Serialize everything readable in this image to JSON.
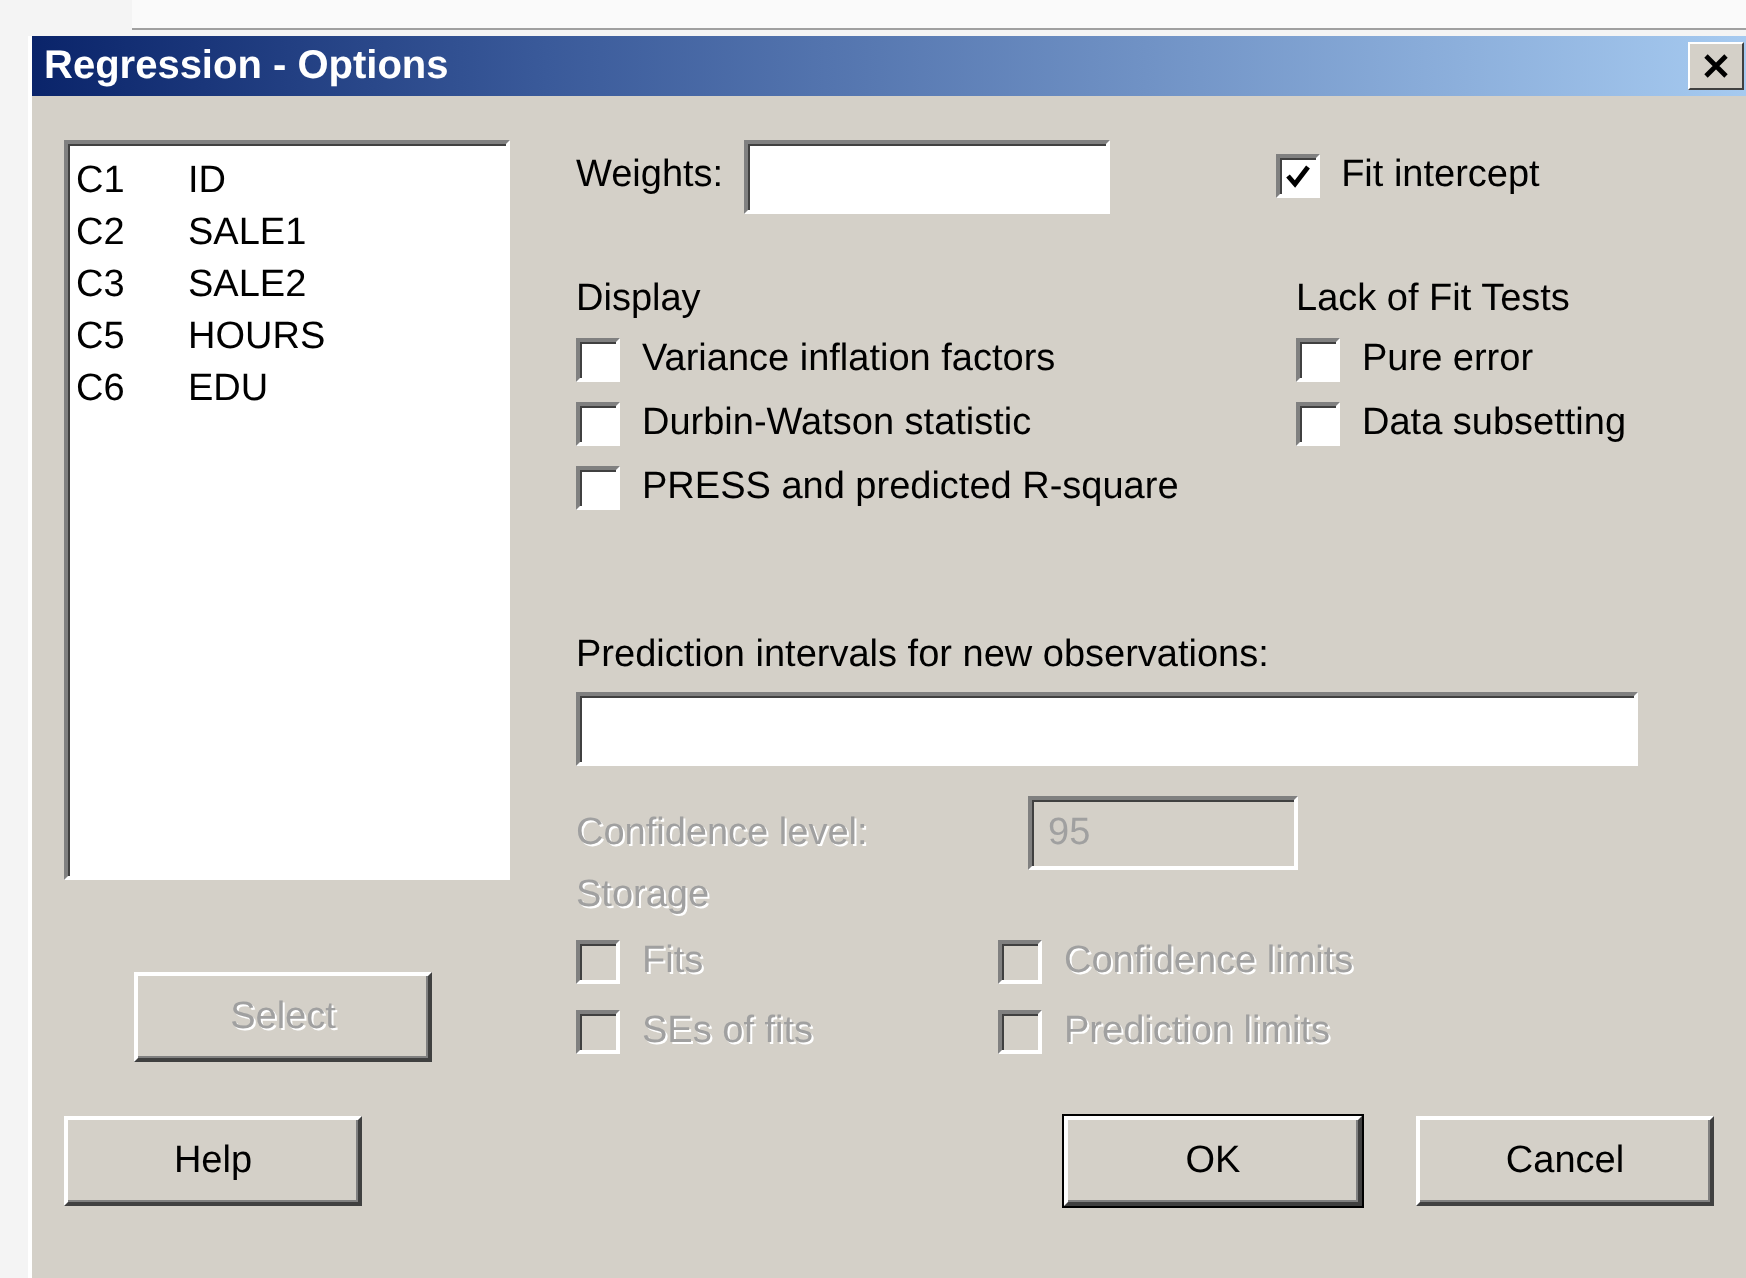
{
  "window": {
    "title": "Regression - Options"
  },
  "variables": [
    {
      "column": "C1",
      "name": "ID"
    },
    {
      "column": "C2",
      "name": "SALE1"
    },
    {
      "column": "C3",
      "name": "SALE2"
    },
    {
      "column": "C5",
      "name": "HOURS"
    },
    {
      "column": "C6",
      "name": "EDU"
    }
  ],
  "weights": {
    "label": "Weights:"
  },
  "fit_intercept": {
    "label": "Fit intercept",
    "checked": true
  },
  "display": {
    "heading": "Display",
    "options": [
      {
        "label": "Variance inflation factors",
        "checked": false
      },
      {
        "label": "Durbin-Watson statistic",
        "checked": false
      },
      {
        "label": "PRESS and predicted R-square",
        "checked": false
      }
    ]
  },
  "lack_of_fit": {
    "heading": "Lack of Fit Tests",
    "options": [
      {
        "label": "Pure error",
        "checked": false
      },
      {
        "label": "Data subsetting",
        "checked": false
      }
    ]
  },
  "prediction": {
    "label": "Prediction intervals for new observations:"
  },
  "confidence": {
    "label": "Confidence level:",
    "value": "95",
    "disabled": true
  },
  "storage": {
    "heading": "Storage",
    "disabled": true,
    "options": [
      {
        "label": "Fits",
        "checked": false
      },
      {
        "label": "Confidence limits",
        "checked": false
      },
      {
        "label": "SEs of fits",
        "checked": false
      },
      {
        "label": "Prediction limits",
        "checked": false
      }
    ]
  },
  "select_button": {
    "label": "Select",
    "disabled": true
  },
  "buttons": [
    {
      "label": "Help",
      "default": false
    },
    {
      "label": "OK",
      "default": true
    },
    {
      "label": "Cancel",
      "default": false
    }
  ]
}
